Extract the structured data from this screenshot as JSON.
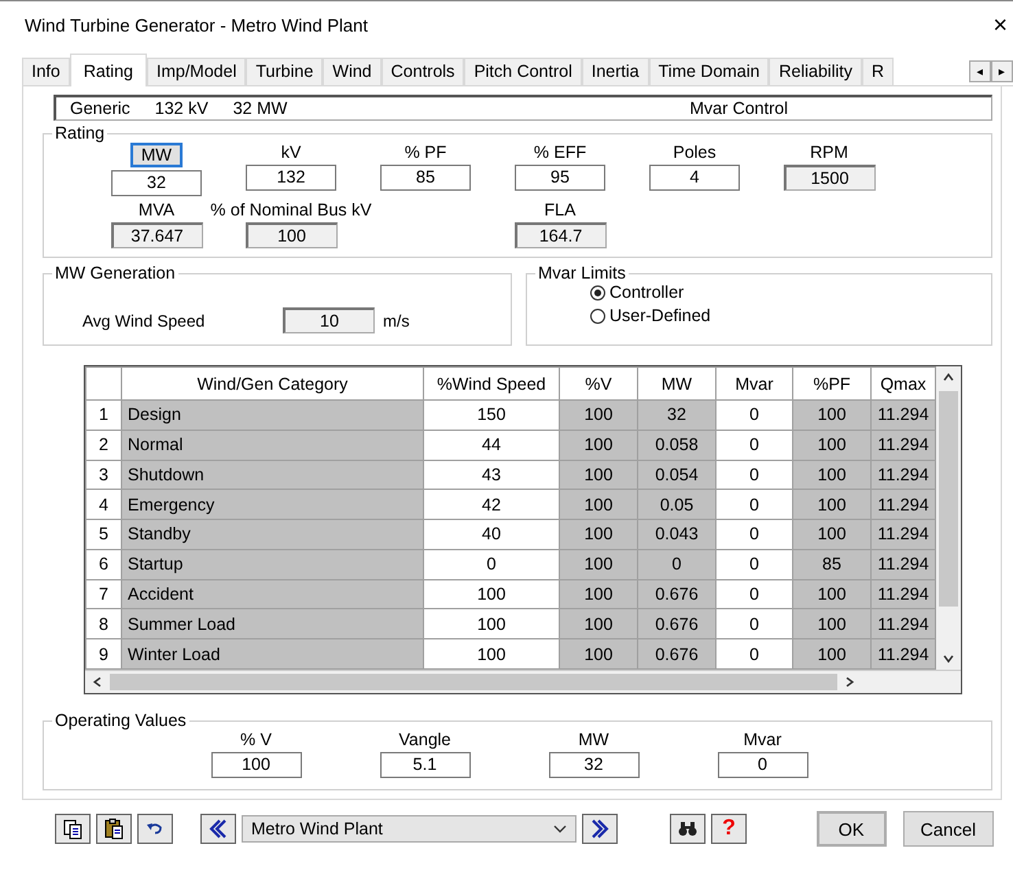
{
  "window": {
    "title": "Wind Turbine Generator - Metro Wind Plant",
    "close": "×"
  },
  "tabs": [
    {
      "label": "Info",
      "selected": false
    },
    {
      "label": "Rating",
      "selected": true
    },
    {
      "label": "Imp/Model",
      "selected": false
    },
    {
      "label": "Turbine",
      "selected": false
    },
    {
      "label": "Wind",
      "selected": false
    },
    {
      "label": "Controls",
      "selected": false
    },
    {
      "label": "Pitch Control",
      "selected": false
    },
    {
      "label": "Inertia",
      "selected": false
    },
    {
      "label": "Time Domain",
      "selected": false
    },
    {
      "label": "Reliability",
      "selected": false
    },
    {
      "label": "R",
      "selected": false
    }
  ],
  "tab_scroll": [
    "◂",
    "▸"
  ],
  "summary": {
    "items": [
      "Generic",
      "132 kV",
      "32 MW"
    ],
    "right": "Mvar Control"
  },
  "rating": {
    "title": "Rating",
    "row_1": [
      {
        "label": "MW",
        "kind": "button",
        "value": "32",
        "readonly": false
      },
      {
        "label": "kV",
        "kind": "text",
        "value": "132",
        "readonly": false
      },
      {
        "label": "% PF",
        "kind": "text",
        "value": "85",
        "readonly": false
      },
      {
        "label": "% EFF",
        "kind": "text",
        "value": "95",
        "readonly": false
      },
      {
        "label": "Poles",
        "kind": "text",
        "value": "4",
        "readonly": false
      },
      {
        "label": "RPM",
        "kind": "text",
        "value": "1500",
        "readonly": true
      }
    ],
    "row_2": [
      {
        "label": "MVA",
        "kind": "text",
        "value": "37.647",
        "readonly": true
      },
      {
        "label": "% of Nominal Bus kV",
        "kind": "text",
        "value": "100",
        "readonly": true
      },
      {
        "label": "FLA",
        "kind": "text",
        "value": "164.7",
        "readonly": true
      }
    ]
  },
  "mw_generation": {
    "title": "MW Generation",
    "label": "Avg Wind Speed",
    "value": "10",
    "readonly": true,
    "unit": "m/s"
  },
  "mvar_limits": {
    "title": "Mvar Limits",
    "options": [
      {
        "label": "Controller",
        "selected": true
      },
      {
        "label": "User-Defined",
        "selected": false
      }
    ]
  },
  "table": {
    "columns": [
      {
        "shaded": false
      },
      {
        "label": "Wind/Gen Category",
        "shaded": true
      },
      {
        "label": "%Wind Speed",
        "shaded": false
      },
      {
        "label": "%V",
        "shaded": true
      },
      {
        "label": "MW",
        "shaded": true
      },
      {
        "label": "Mvar",
        "shaded": false
      },
      {
        "label": "%PF",
        "shaded": true
      },
      {
        "label": "Qmax",
        "shaded": true
      }
    ],
    "rows": [
      [
        "1",
        "Design",
        "150",
        "100",
        "32",
        "0",
        "100",
        "11.294"
      ],
      [
        "2",
        "Normal",
        "44",
        "100",
        "0.058",
        "0",
        "100",
        "11.294"
      ],
      [
        "3",
        "Shutdown",
        "43",
        "100",
        "0.054",
        "0",
        "100",
        "11.294"
      ],
      [
        "4",
        "Emergency",
        "42",
        "100",
        "0.05",
        "0",
        "100",
        "11.294"
      ],
      [
        "5",
        "Standby",
        "40",
        "100",
        "0.043",
        "0",
        "100",
        "11.294"
      ],
      [
        "6",
        "Startup",
        "0",
        "100",
        "0",
        "0",
        "85",
        "11.294"
      ],
      [
        "7",
        "Accident",
        "100",
        "100",
        "0.676",
        "0",
        "100",
        "11.294"
      ],
      [
        "8",
        "Summer Load",
        "100",
        "100",
        "0.676",
        "0",
        "100",
        "11.294"
      ],
      [
        "9",
        "Winter Load",
        "100",
        "100",
        "0.676",
        "0",
        "100",
        "11.294"
      ]
    ]
  },
  "operating_values": {
    "title": "Operating Values",
    "fields": [
      {
        "label": "% V",
        "value": "100"
      },
      {
        "label": "Vangle",
        "value": "5.1"
      },
      {
        "label": "MW",
        "value": "32"
      },
      {
        "label": "Mvar",
        "value": "0"
      }
    ]
  },
  "toolbar": {
    "dropdown": "Metro Wind Plant",
    "help": "?"
  },
  "buttons": [
    "OK",
    "Cancel"
  ]
}
